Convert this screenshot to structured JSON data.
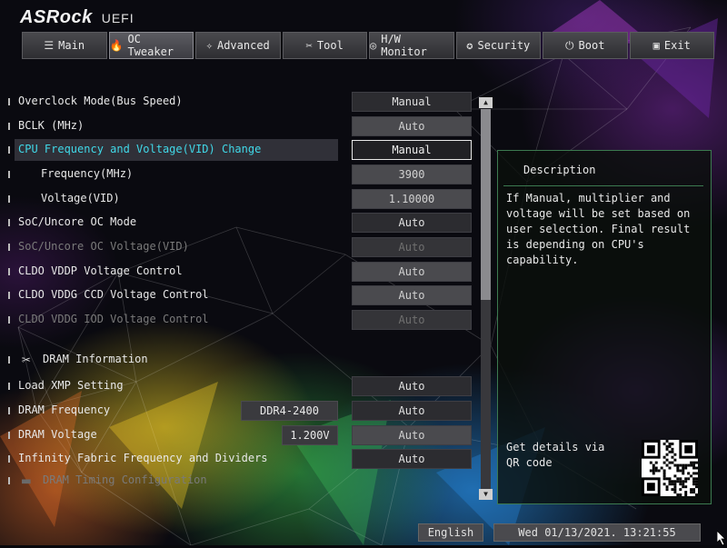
{
  "header": {
    "brand": "ASRock",
    "product": "UEFI"
  },
  "tabs": [
    {
      "label": "Main",
      "icon": "list-icon",
      "glyph": "☰",
      "active": false
    },
    {
      "label": "OC Tweaker",
      "icon": "flame-icon",
      "glyph": "🔥",
      "active": true
    },
    {
      "label": "Advanced",
      "icon": "star-icon",
      "glyph": "✧",
      "active": false
    },
    {
      "label": "Tool",
      "icon": "tools-icon",
      "glyph": "✂",
      "active": false
    },
    {
      "label": "H/W Monitor",
      "icon": "monitor-icon",
      "glyph": "◎",
      "active": false
    },
    {
      "label": "Security",
      "icon": "shield-icon",
      "glyph": "✪",
      "active": false
    },
    {
      "label": "Boot",
      "icon": "power-icon",
      "glyph": "⏻",
      "active": false
    },
    {
      "label": "Exit",
      "icon": "exit-icon",
      "glyph": "▣",
      "active": false
    }
  ],
  "settings": [
    {
      "label": "Overclock Mode(Bus Speed)",
      "value": "Manual"
    },
    {
      "label": "BCLK (MHz)",
      "value": "Auto"
    },
    {
      "label": "CPU Frequency and Voltage(VID) Change",
      "value": "Manual"
    },
    {
      "label": "Frequency(MHz)",
      "value": "3900"
    },
    {
      "label": "Voltage(VID)",
      "value": "1.10000"
    },
    {
      "label": "SoC/Uncore OC Mode",
      "value": "Auto"
    },
    {
      "label": "SoC/Uncore OC Voltage(VID)",
      "value": "Auto"
    },
    {
      "label": "CLDO VDDP Voltage Control",
      "value": "Auto"
    },
    {
      "label": "CLDO VDDG CCD Voltage Control",
      "value": "Auto"
    },
    {
      "label": "CLDO VDDG IOD Voltage Control",
      "value": "Auto"
    },
    {
      "label": "DRAM Information",
      "icon": "tools-icon"
    },
    {
      "label": "Load XMP Setting",
      "value": "Auto"
    },
    {
      "label": "DRAM Frequency",
      "value": "Auto",
      "info": "DDR4-2400"
    },
    {
      "label": "DRAM Voltage",
      "value": "Auto",
      "info": "1.200V"
    },
    {
      "label": "Infinity Fabric Frequency and Dividers",
      "value": "Auto"
    },
    {
      "label": "DRAM Timing Configuration",
      "icon": "folder-icon"
    }
  ],
  "description": {
    "title": "Description",
    "text": "If Manual, multiplier and voltage will be set based on user selection. Final result is depending on CPU's capability.",
    "qr_text": "Get details via QR code"
  },
  "footer": {
    "language": "English",
    "datetime": "Wed 01/13/2021. 13:21:55"
  },
  "colors": {
    "accent": "#40d8e8",
    "panel_border": "#3c7a50"
  }
}
